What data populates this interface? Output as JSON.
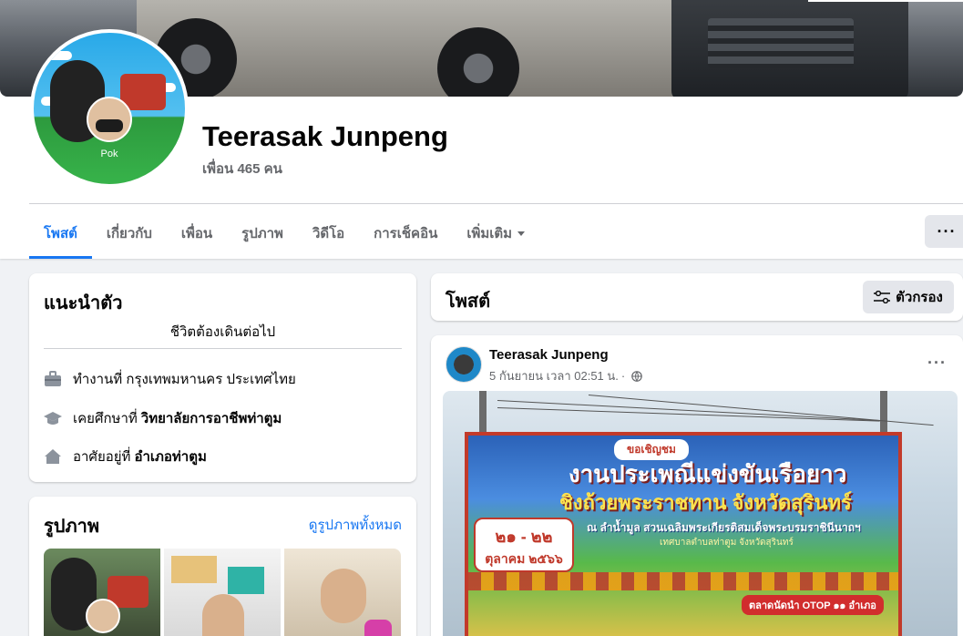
{
  "profile": {
    "name": "Teerasak Junpeng",
    "friends": "เพื่อน 465 คน",
    "avatar_tag": "Pok"
  },
  "tabs": [
    {
      "label": "โพสต์",
      "active": true
    },
    {
      "label": "เกี่ยวกับ",
      "active": false
    },
    {
      "label": "เพื่อน",
      "active": false
    },
    {
      "label": "รูปภาพ",
      "active": false
    },
    {
      "label": "วิดีโอ",
      "active": false
    },
    {
      "label": "การเช็คอิน",
      "active": false
    },
    {
      "label": "เพิ่มเติม",
      "active": false
    }
  ],
  "more_button": "···",
  "intro": {
    "title": "แนะนำตัว",
    "bio": "ชีวิตต้องเดินต่อไป",
    "work": "ทำงานที่ กรุงเทพมหานคร ประเทศไทย",
    "education_prefix": "เคยศึกษาที่",
    "education_place": "วิทยาลัยการอาชีพท่าตูม",
    "lives_prefix": "อาศัยอยู่ที่",
    "lives_place": "อำเภอท่าตูม"
  },
  "photos": {
    "title": "รูปภาพ",
    "see_all": "ดูรูปภาพทั้งหมด"
  },
  "posts_header": {
    "title": "โพสต์",
    "filter_label": "ตัวกรอง"
  },
  "post": {
    "author": "Teerasak Junpeng",
    "timestamp": "5 กันยายน เวลา 02:51 น.",
    "separator": "·",
    "more": "···",
    "banner": {
      "invite": "ขอเชิญชม",
      "headline1": "งานประเพณีแข่งขันเรือยาว",
      "headline2": "ชิงถ้วยพระราชทาน จังหวัดสุรินทร์",
      "date_num": "๒๑ - ๒๒",
      "date_month": "ตุลาคม ๒๕๖๖",
      "venue": "ณ ลำน้ำมูล สวนเฉลิมพระเกียรติสมเด็จพระบรมราชินีนาถฯ",
      "venue2": "เทศบาลตำบลท่าตูม จังหวัดสุรินทร์",
      "otop": "ตลาดนัดนำ OTOP ๑๑ อำเภอ"
    }
  },
  "colors": {
    "accent": "#1877f2",
    "muted": "#65676b",
    "background": "#f0f2f5"
  }
}
